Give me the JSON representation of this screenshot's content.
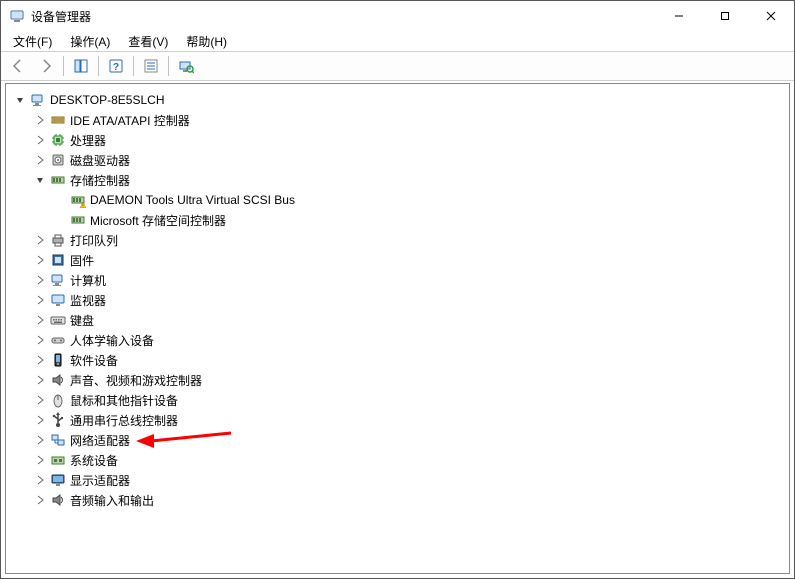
{
  "window": {
    "title": "设备管理器"
  },
  "menu": {
    "file": "文件(F)",
    "action": "操作(A)",
    "view": "查看(V)",
    "help": "帮助(H)"
  },
  "toolbar": {
    "back": "back",
    "forward": "forward",
    "showhide": "show-hide",
    "help": "help",
    "details": "details",
    "scan": "scan"
  },
  "tree": {
    "root": {
      "label": "DESKTOP-8E5SLCH",
      "expanded": true
    },
    "categories": [
      {
        "id": "ide",
        "label": "IDE ATA/ATAPI 控制器",
        "icon": "ide-icon",
        "expanded": false,
        "children": []
      },
      {
        "id": "cpu",
        "label": "处理器",
        "icon": "cpu-icon",
        "expanded": false,
        "children": []
      },
      {
        "id": "disk",
        "label": "磁盘驱动器",
        "icon": "disk-icon",
        "expanded": false,
        "children": []
      },
      {
        "id": "storage",
        "label": "存储控制器",
        "icon": "storage-icon",
        "expanded": true,
        "children": [
          {
            "id": "daemon",
            "label": "DAEMON Tools Ultra Virtual SCSI Bus",
            "icon": "storage-item-icon",
            "warn": true
          },
          {
            "id": "msspace",
            "label": "Microsoft 存储空间控制器",
            "icon": "storage-item-icon",
            "warn": false
          }
        ]
      },
      {
        "id": "printq",
        "label": "打印队列",
        "icon": "printer-icon",
        "expanded": false,
        "children": []
      },
      {
        "id": "firmware",
        "label": "固件",
        "icon": "firmware-icon",
        "expanded": false,
        "children": []
      },
      {
        "id": "computer",
        "label": "计算机",
        "icon": "computer-icon",
        "expanded": false,
        "children": []
      },
      {
        "id": "monitor",
        "label": "监视器",
        "icon": "monitor-icon",
        "expanded": false,
        "children": []
      },
      {
        "id": "keyboard",
        "label": "键盘",
        "icon": "keyboard-icon",
        "expanded": false,
        "children": []
      },
      {
        "id": "hid",
        "label": "人体学输入设备",
        "icon": "hid-icon",
        "expanded": false,
        "children": []
      },
      {
        "id": "software",
        "label": "软件设备",
        "icon": "software-icon",
        "expanded": false,
        "children": []
      },
      {
        "id": "sound",
        "label": "声音、视频和游戏控制器",
        "icon": "audio-icon",
        "expanded": false,
        "children": []
      },
      {
        "id": "mouse",
        "label": "鼠标和其他指针设备",
        "icon": "mouse-icon",
        "expanded": false,
        "children": []
      },
      {
        "id": "usb",
        "label": "通用串行总线控制器",
        "icon": "usb-icon",
        "expanded": false,
        "children": []
      },
      {
        "id": "network",
        "label": "网络适配器",
        "icon": "network-icon",
        "expanded": false,
        "children": [],
        "highlight": true
      },
      {
        "id": "system",
        "label": "系统设备",
        "icon": "system-icon",
        "expanded": false,
        "children": []
      },
      {
        "id": "display",
        "label": "显示适配器",
        "icon": "display-icon",
        "expanded": false,
        "children": []
      },
      {
        "id": "audioio",
        "label": "音频输入和输出",
        "icon": "audio-icon",
        "expanded": false,
        "children": []
      }
    ]
  },
  "annotation": {
    "arrow_color": "#ff0000",
    "direction": "left",
    "target": "network"
  }
}
